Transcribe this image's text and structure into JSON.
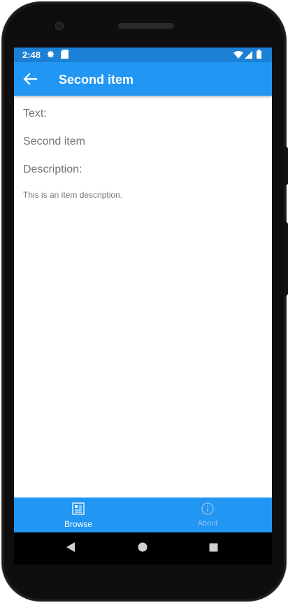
{
  "status_bar": {
    "time": "2:48",
    "icons": [
      "gear-icon",
      "sd-card-icon",
      "wifi-icon",
      "signal-icon",
      "battery-icon"
    ]
  },
  "app_bar": {
    "title": "Second item",
    "back_icon": "arrow-left-icon"
  },
  "detail": {
    "text_label": "Text:",
    "text_value": "Second item",
    "description_label": "Description:",
    "description_value": "This is an item description."
  },
  "tabs": [
    {
      "label": "Browse",
      "icon": "browse-list-icon",
      "selected": true
    },
    {
      "label": "About",
      "icon": "info-icon",
      "selected": false
    }
  ],
  "nav": [
    "back-triangle-icon",
    "home-circle-icon",
    "recents-square-icon"
  ],
  "colors": {
    "primary": "#2196F3",
    "status_bar": "#1b80d6",
    "text_secondary": "#757575",
    "tab_selected": "#ffffff",
    "tab_unselected": "#95C2F2"
  }
}
